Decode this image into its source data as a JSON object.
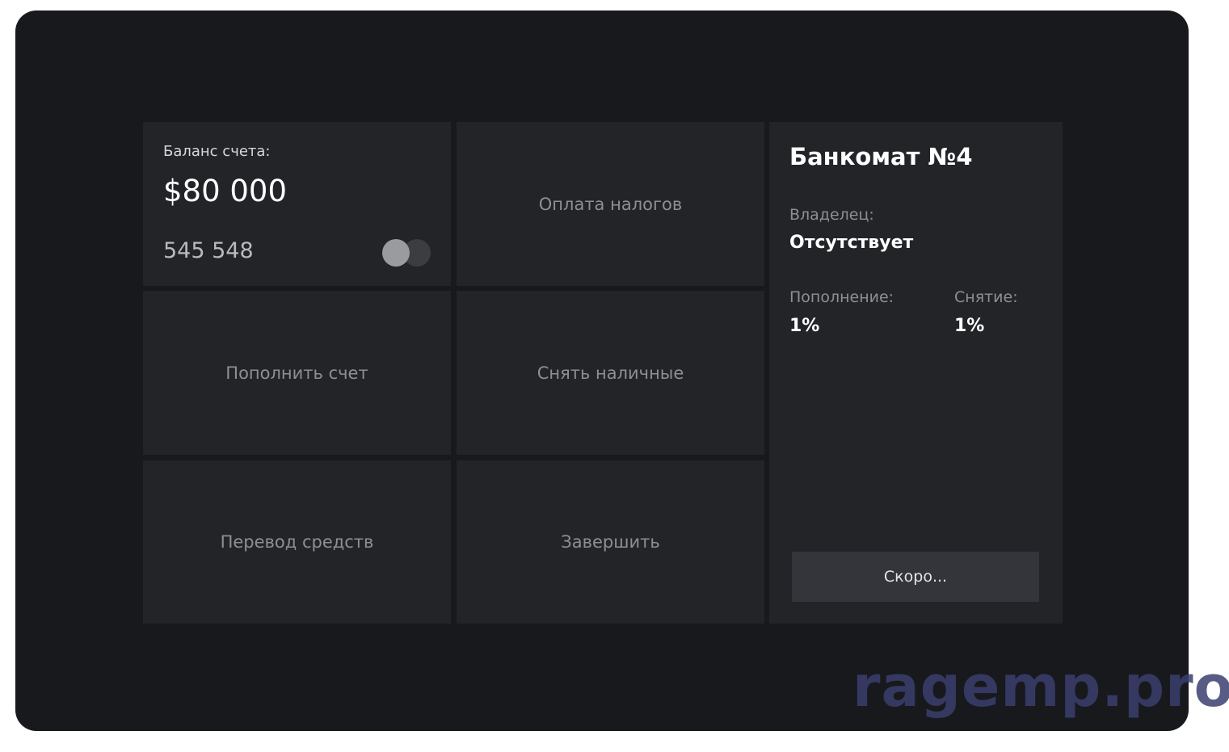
{
  "balance": {
    "label": "Баланс счета:",
    "amount": "$80 000",
    "card_number": "545 548",
    "card_logo_icon": "card-brand-circles-icon"
  },
  "actions": {
    "taxes": "Оплата налогов",
    "deposit": "Пополнить счет",
    "withdraw": "Снять наличные",
    "transfer": "Перевод средств",
    "finish": "Завершить"
  },
  "atm": {
    "title": "Банкомат №4",
    "owner_label": "Владелец:",
    "owner_value": "Отсутствует",
    "deposit_fee_label": "Пополнение:",
    "deposit_fee_value": "1%",
    "withdraw_fee_label": "Снятие:",
    "withdraw_fee_value": "1%",
    "soon_button": "Скоро..."
  },
  "watermark": "ragemp.pro",
  "colors": {
    "background": "#18191d",
    "tile": "#232428",
    "button": "#34353a",
    "muted_text": "#8e8f93",
    "watermark": "#3b3f6e"
  }
}
